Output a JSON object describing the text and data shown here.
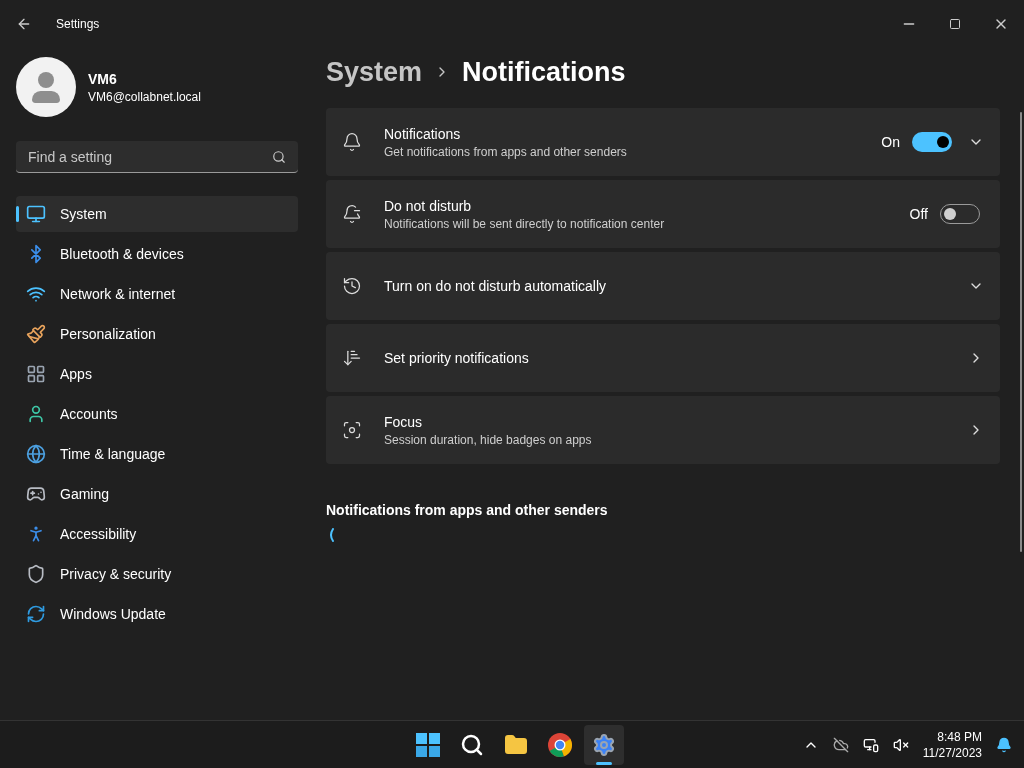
{
  "window": {
    "title": "Settings"
  },
  "user": {
    "name": "VM6",
    "email": "VM6@collabnet.local"
  },
  "search": {
    "placeholder": "Find a setting"
  },
  "nav": [
    {
      "label": "System",
      "selected": true
    },
    {
      "label": "Bluetooth & devices",
      "selected": false
    },
    {
      "label": "Network & internet",
      "selected": false
    },
    {
      "label": "Personalization",
      "selected": false
    },
    {
      "label": "Apps",
      "selected": false
    },
    {
      "label": "Accounts",
      "selected": false
    },
    {
      "label": "Time & language",
      "selected": false
    },
    {
      "label": "Gaming",
      "selected": false
    },
    {
      "label": "Accessibility",
      "selected": false
    },
    {
      "label": "Privacy & security",
      "selected": false
    },
    {
      "label": "Windows Update",
      "selected": false
    }
  ],
  "breadcrumb": {
    "parent": "System",
    "current": "Notifications"
  },
  "cards": [
    {
      "kind": "toggle-expand",
      "title": "Notifications",
      "subtitle": "Get notifications from apps and other senders",
      "state_label": "On",
      "on": true
    },
    {
      "kind": "toggle",
      "title": "Do not disturb",
      "subtitle": "Notifications will be sent directly to notification center",
      "state_label": "Off",
      "on": false
    },
    {
      "kind": "expand",
      "title": "Turn on do not disturb automatically"
    },
    {
      "kind": "link",
      "title": "Set priority notifications"
    },
    {
      "kind": "link",
      "title": "Focus",
      "subtitle": "Session duration, hide badges on apps"
    }
  ],
  "section_heading": "Notifications from apps and other senders",
  "taskbar": {
    "apps": [
      {
        "selected": false
      },
      {
        "selected": false
      },
      {
        "selected": false
      },
      {
        "selected": false
      },
      {
        "selected": true
      }
    ],
    "time": "8:48 PM",
    "date": "11/27/2023"
  }
}
